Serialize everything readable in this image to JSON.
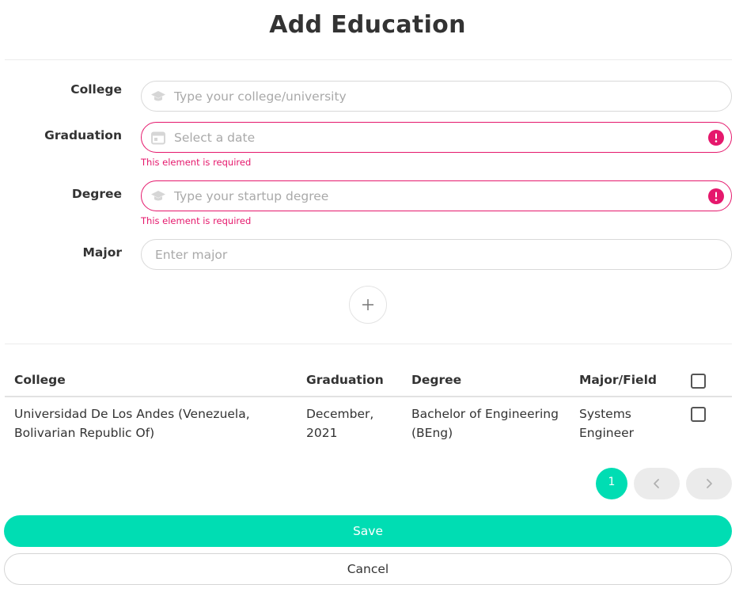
{
  "dialog": {
    "title": "Add Education"
  },
  "form": {
    "college": {
      "label": "College",
      "placeholder": "Type your college/university",
      "icon": "graduation-cap-icon"
    },
    "graduation": {
      "label": "Graduation",
      "placeholder": "Select a date",
      "icon": "calendar-icon",
      "error": "This element is required"
    },
    "degree": {
      "label": "Degree",
      "placeholder": "Type your startup degree",
      "icon": "graduation-cap-icon",
      "error": "This element is required"
    },
    "major": {
      "label": "Major",
      "placeholder": "Enter major"
    },
    "add_icon": "plus-icon",
    "error_icon": "exclamation-circle-icon"
  },
  "table": {
    "columns": [
      "College",
      "Graduation",
      "Degree",
      "Major/Field"
    ],
    "rows": [
      {
        "college": "Universidad De Los Andes (Venezuela, Bolivarian Republic Of)",
        "graduation": "December, 2021",
        "degree": "Bachelor of Engineering (BEng)",
        "major": "Systems Engineer",
        "checked": false
      }
    ]
  },
  "pagination": {
    "current_page": "1",
    "prev_icon": "chevron-left-icon",
    "next_icon": "chevron-right-icon"
  },
  "actions": {
    "save_label": "Save",
    "cancel_label": "Cancel"
  },
  "colors": {
    "accent": "#00ddb3",
    "error": "#e5186c",
    "text": "#333333",
    "placeholder": "#a9a9a9"
  }
}
